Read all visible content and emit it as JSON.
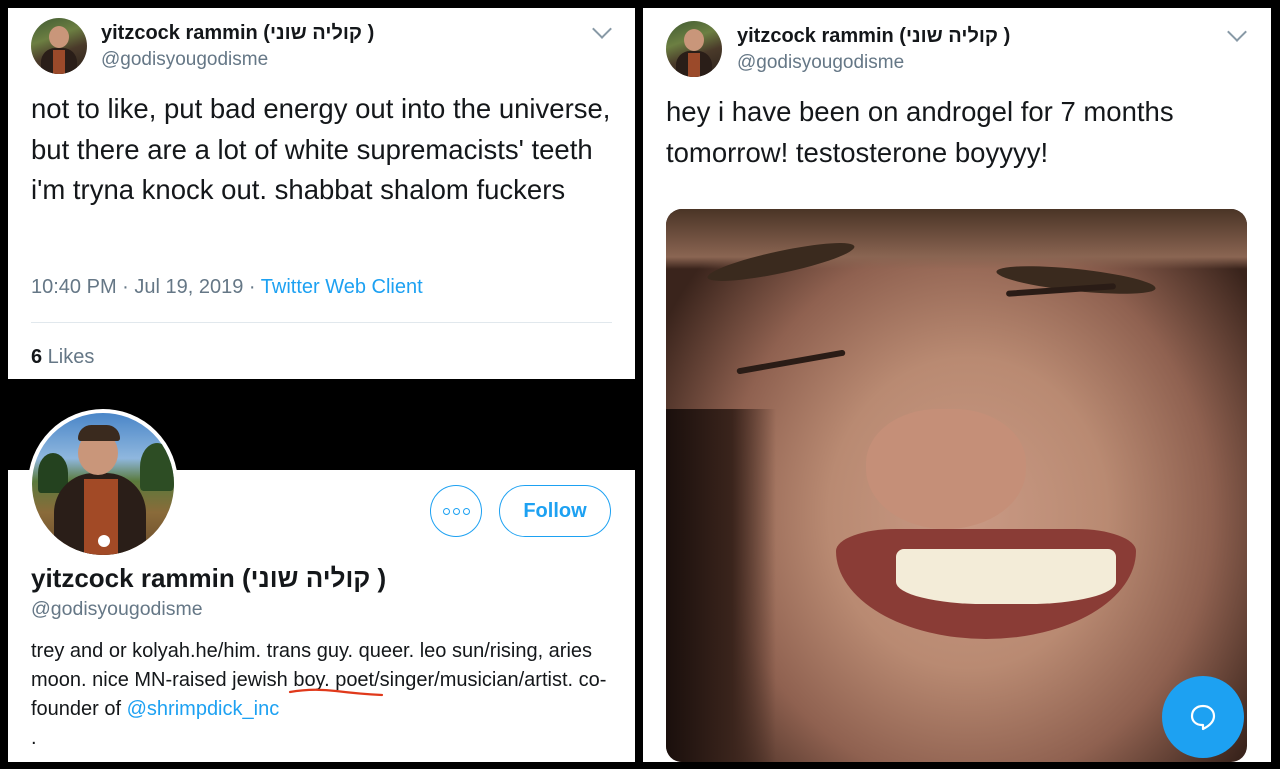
{
  "tweet1": {
    "display_name": "yitzcock rammin (קוליה שוני )",
    "handle": "@godisyougodisme",
    "text": "not to like, put bad energy out into the universe, but there are a lot of white supremacists' teeth i'm tryna knock out. shabbat shalom fuckers",
    "timestamp": "10:40 PM · Jul 19, 2019 · ",
    "source": "Twitter Web Client",
    "likes_count": "6",
    "likes_label": " Likes"
  },
  "profile": {
    "display_name": "yitzcock rammin (קוליה שוני )",
    "handle": "@godisyougodisme",
    "follow_label": "Follow",
    "bio_part1": "trey and or kolyah.he/him. trans guy. queer. leo sun/rising, aries moon. nice MN-raised jewish boy. poet/singer/musician/artist. co-founder of ",
    "bio_link": "@shrimpdick_inc",
    "bio_part2": " ."
  },
  "tweet2": {
    "display_name": "yitzcock rammin (קוליה שוני )",
    "handle": "@godisyougodisme",
    "text": "hey i have been on androgel for 7 months tomorrow! testosterone boyyyy!"
  },
  "colors": {
    "accent": "#1da1f2",
    "text": "#14171a",
    "muted": "#657786",
    "underline": "#e0391b"
  },
  "icons": {
    "caret": "chevron-down-icon",
    "more": "more-icon",
    "compose": "compose-message-icon"
  }
}
